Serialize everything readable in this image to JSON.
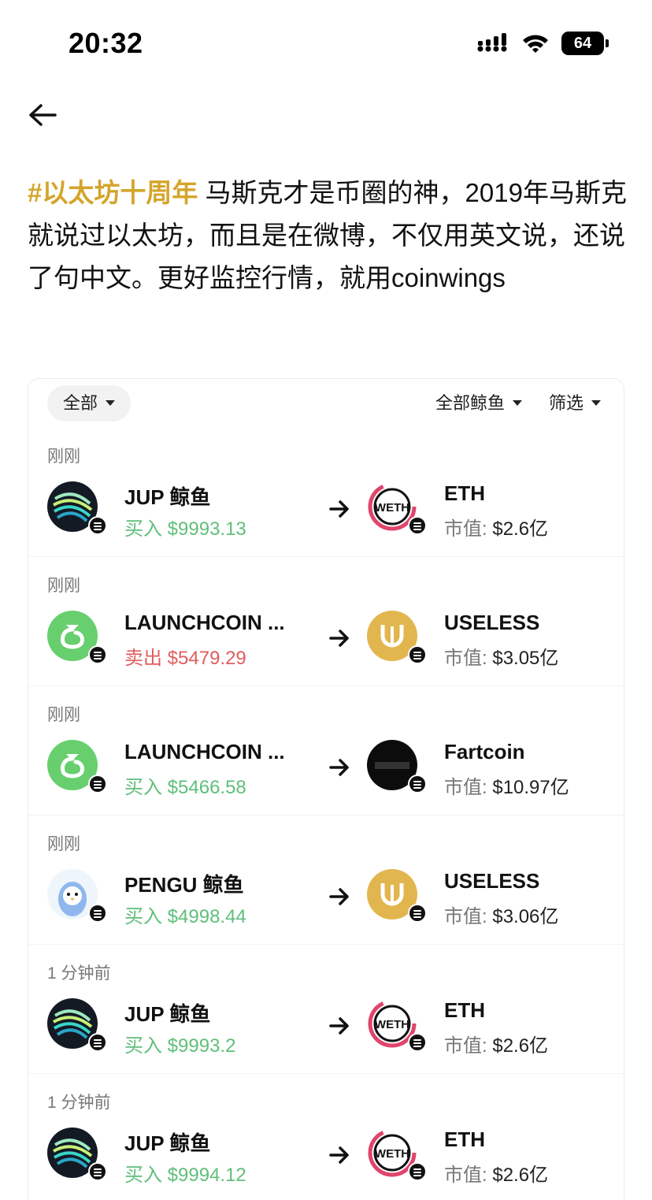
{
  "status_bar": {
    "time": "20:32",
    "battery": "64"
  },
  "post": {
    "hashtag": "#以太坊十周年",
    "body": " 马斯克才是币圈的神，2019年马斯克就说过以太坊，而且是在微博，不仅用英文说，还说了句中文。更好监控行情，就用coinwings"
  },
  "filters": {
    "all": "全部",
    "whale": "全部鲸鱼",
    "screen": "筛选"
  },
  "mcap_label": "市值:",
  "trades": [
    {
      "time": "刚刚",
      "from_name": "JUP 鲸鱼",
      "from_icon": "jup-logo",
      "action": "买入",
      "amount": "$9993.13",
      "type": "buy",
      "to_name": "ETH",
      "to_icon": "weth-logo",
      "mcap": "$2.6亿"
    },
    {
      "time": "刚刚",
      "from_name": "LAUNCHCOIN ...",
      "from_icon": "launchcoin-logo",
      "action": "卖出",
      "amount": "$5479.29",
      "type": "sell",
      "to_name": "USELESS",
      "to_icon": "useless-logo",
      "mcap": "$3.05亿"
    },
    {
      "time": "刚刚",
      "from_name": "LAUNCHCOIN ...",
      "from_icon": "launchcoin-logo",
      "action": "买入",
      "amount": "$5466.58",
      "type": "buy",
      "to_name": "Fartcoin",
      "to_icon": "fartcoin-logo",
      "mcap": "$10.97亿"
    },
    {
      "time": "刚刚",
      "from_name": "PENGU 鲸鱼",
      "from_icon": "pengu-logo",
      "action": "买入",
      "amount": "$4998.44",
      "type": "buy",
      "to_name": "USELESS",
      "to_icon": "useless-logo",
      "mcap": "$3.06亿"
    },
    {
      "time": "1 分钟前",
      "from_name": "JUP 鲸鱼",
      "from_icon": "jup-logo",
      "action": "买入",
      "amount": "$9993.2",
      "type": "buy",
      "to_name": "ETH",
      "to_icon": "weth-logo",
      "mcap": "$2.6亿"
    },
    {
      "time": "1 分钟前",
      "from_name": "JUP 鲸鱼",
      "from_icon": "jup-logo",
      "action": "买入",
      "amount": "$9994.12",
      "type": "buy",
      "to_name": "ETH",
      "to_icon": "weth-logo",
      "mcap": "$2.6亿"
    }
  ],
  "colors": {
    "hashtag": "#d4a52a",
    "buy": "#5fbf7a",
    "sell": "#e05d5d"
  }
}
